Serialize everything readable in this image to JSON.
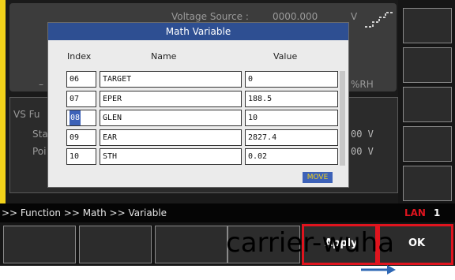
{
  "top": {
    "voltage_label": "Voltage Source :",
    "voltage_value": "0000.000",
    "voltage_unit": "V",
    "left_dash": "–",
    "rh_unit": "%RH"
  },
  "mid": {
    "vs_label": "VS Fu",
    "st_label": "Sta",
    "po_label": "Poi",
    "row1_value": "00  V",
    "row2_value": "00  V"
  },
  "dialog": {
    "title": "Math Variable",
    "headers": {
      "index": "Index",
      "name": "Name",
      "value": "Value"
    },
    "rows": [
      {
        "index": "06",
        "name": "TARGET",
        "value": "0"
      },
      {
        "index": "07",
        "name": "EPER",
        "value": "188.5"
      },
      {
        "index": "08",
        "name": "GLEN",
        "value": "10"
      },
      {
        "index": "09",
        "name": "EAR",
        "value": "2827.4"
      },
      {
        "index": "10",
        "name": "STH",
        "value": "0.02"
      }
    ],
    "move_label": "MOVE"
  },
  "status": {
    "path": ">> Function >> Math >> Variable",
    "lan": "LAN",
    "lan_number": "1"
  },
  "buttons": {
    "apply": "Apply",
    "ok": "OK"
  },
  "watermark": "carrier-wuha",
  "colors": {
    "accent_yellow": "#f2d21a",
    "title_blue": "#2e4f92",
    "highlight_red": "#e0141e",
    "lan_red": "#e0141e",
    "arrow_blue": "#2e67b4"
  }
}
